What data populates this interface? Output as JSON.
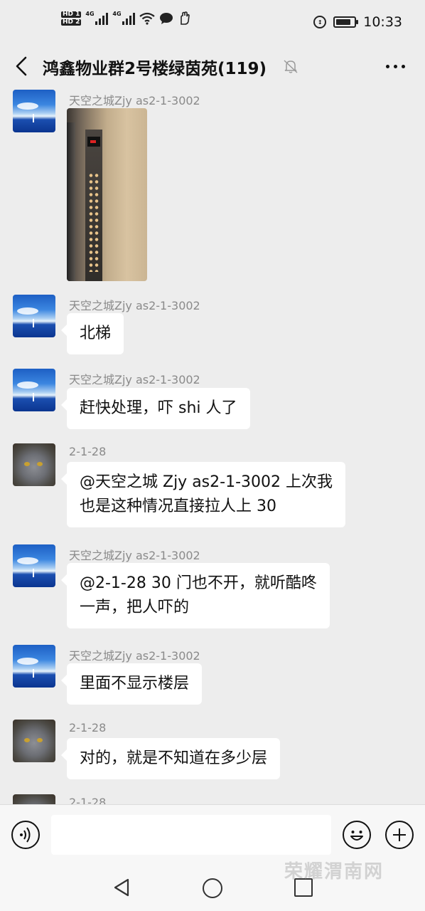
{
  "status_bar": {
    "hd1": "HD 1",
    "hd2": "HD 2",
    "net1": "4G",
    "net2": "4G",
    "time": "10:33",
    "battery_level": 0.85
  },
  "header": {
    "title": "鸿鑫物业群2号楼绿茵苑(119)"
  },
  "messages": [
    {
      "sender": "天空之城Zjy as2-1-3002",
      "avatar": "sky-avatar",
      "type": "image",
      "image": "elevator-panel-photo"
    },
    {
      "sender": "天空之城Zjy as2-1-3002",
      "avatar": "sky-avatar",
      "type": "text",
      "lines": [
        "北梯"
      ]
    },
    {
      "sender": "天空之城Zjy as2-1-3002",
      "avatar": "sky-avatar",
      "type": "text",
      "lines": [
        "赶快处理，吓 shi 人了"
      ]
    },
    {
      "sender": "2-1-28",
      "avatar": "cat-avatar",
      "type": "text",
      "lines": [
        "@天空之城 Zjy as2-1-3002  上次我",
        "也是这种情况直接拉人上 30"
      ]
    },
    {
      "sender": "天空之城Zjy as2-1-3002",
      "avatar": "sky-avatar",
      "type": "text",
      "lines": [
        "@2-1-28 30 门也不开，就听酷咚",
        "一声，把人吓的"
      ]
    },
    {
      "sender": "天空之城Zjy as2-1-3002",
      "avatar": "sky-avatar",
      "type": "text",
      "lines": [
        "里面不显示楼层"
      ]
    },
    {
      "sender": "2-1-28",
      "avatar": "cat-avatar",
      "type": "text",
      "lines": [
        "对的，就是不知道在多少层"
      ]
    },
    {
      "sender": "2-1-28",
      "avatar": "cat-avatar",
      "type": "partial"
    }
  ],
  "input": {
    "placeholder": ""
  },
  "watermark": "荣耀渭南网"
}
